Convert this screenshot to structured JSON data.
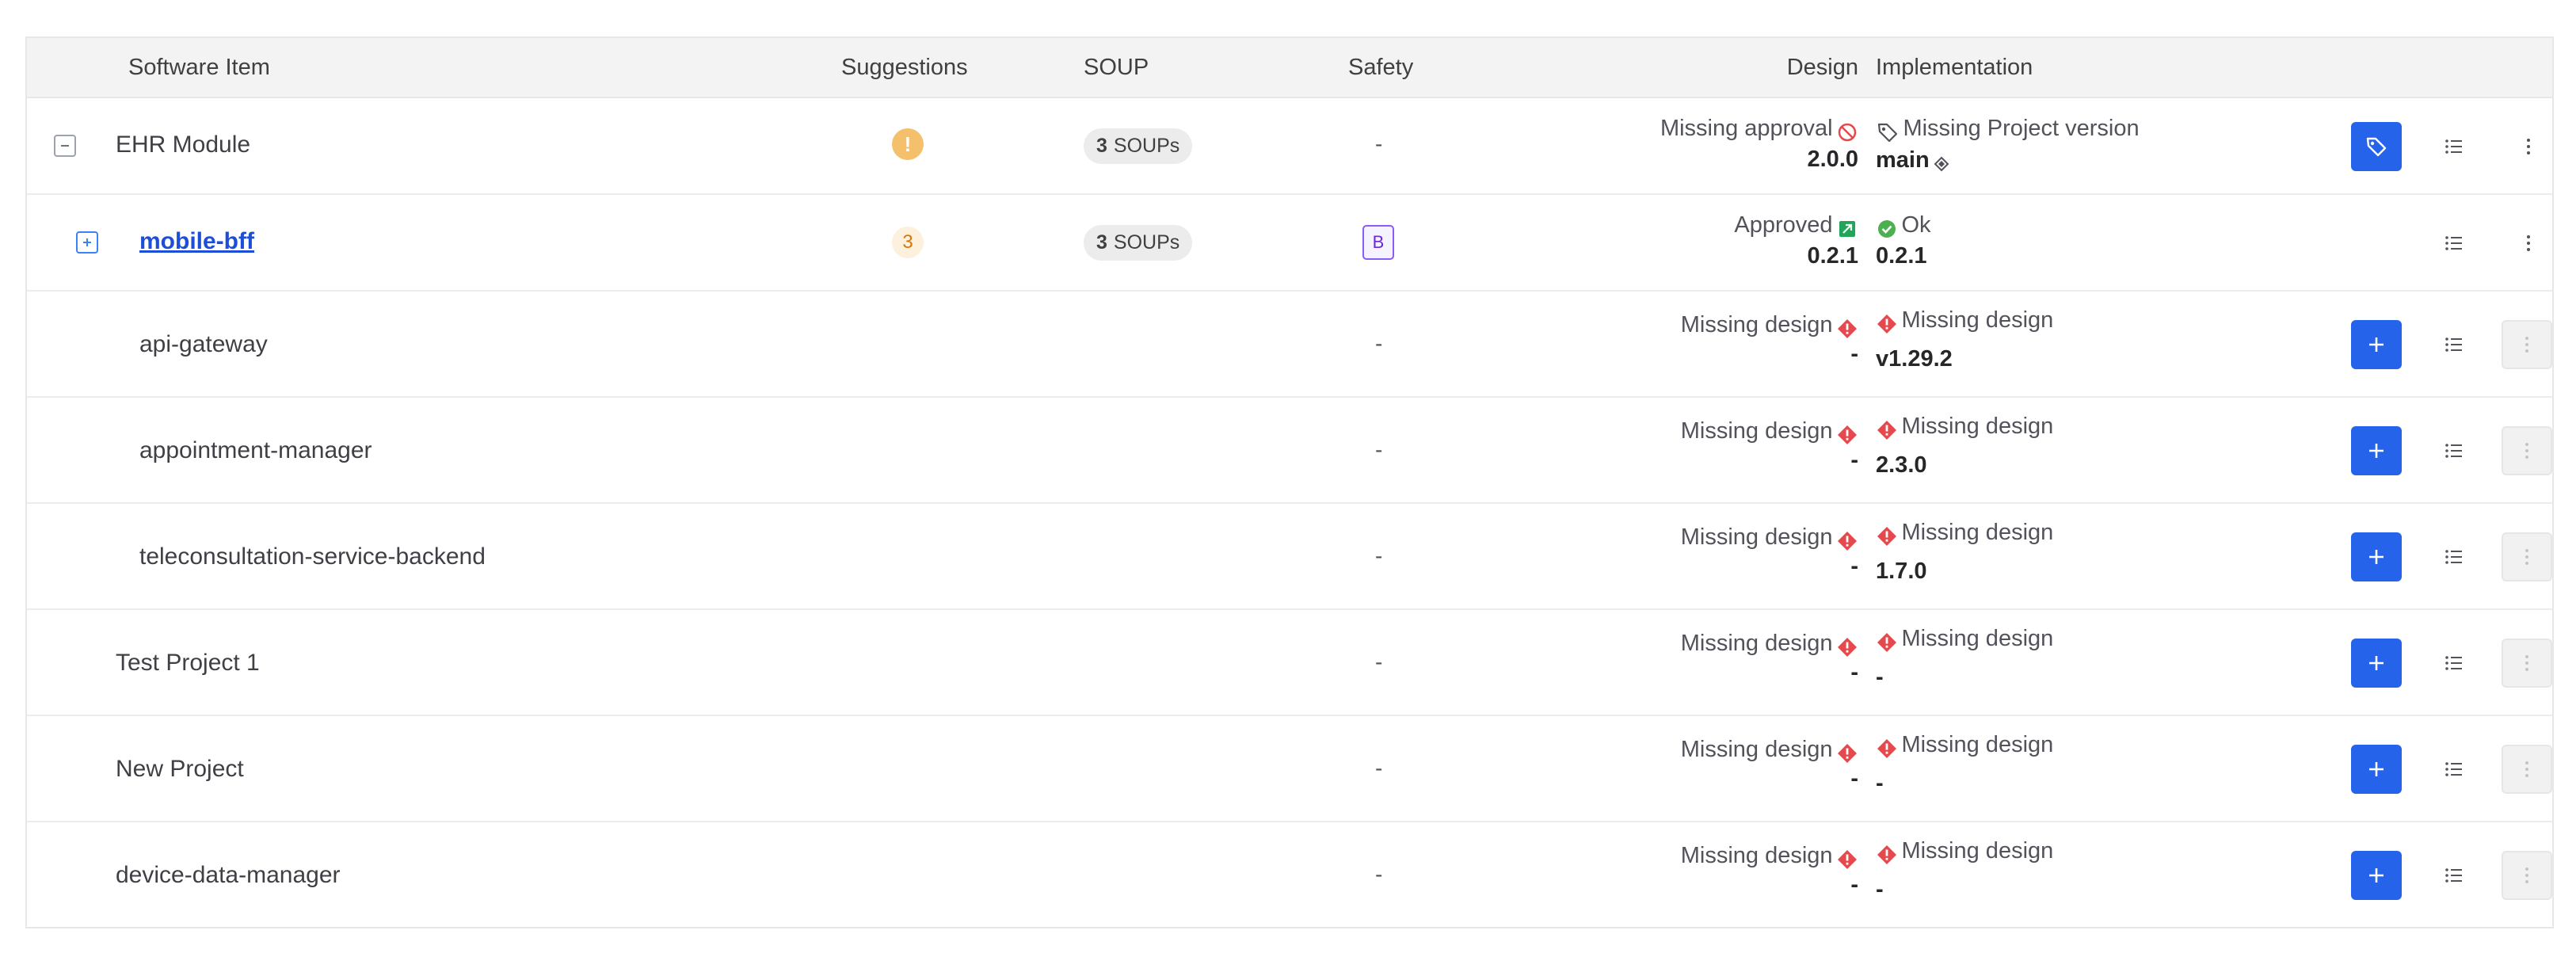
{
  "headers": {
    "software_item": "Software Item",
    "suggestions": "Suggestions",
    "soup": "SOUP",
    "safety": "Safety",
    "design": "Design",
    "implementation": "Implementation"
  },
  "rows": [
    {
      "name": "EHR Module",
      "suggestion_badge": "!",
      "soup_count": "3",
      "soup_label": "SOUPs",
      "safety": "-",
      "design_status": "Missing approval",
      "design_version": "2.0.0",
      "impl_status": "Missing Project version",
      "impl_version": "main"
    },
    {
      "name": "mobile-bff",
      "suggestion_count": "3",
      "soup_count": "3",
      "soup_label": "SOUPs",
      "safety_class": "B",
      "design_status": "Approved",
      "design_version": "0.2.1",
      "impl_status": "Ok",
      "impl_version": "0.2.1"
    },
    {
      "name": "api-gateway",
      "safety": "-",
      "design_status": "Missing design",
      "design_version": "-",
      "impl_status": "Missing design",
      "impl_version": "v1.29.2"
    },
    {
      "name": "appointment-manager",
      "safety": "-",
      "design_status": "Missing design",
      "design_version": "-",
      "impl_status": "Missing design",
      "impl_version": "2.3.0"
    },
    {
      "name": "teleconsultation-service-backend",
      "safety": "-",
      "design_status": "Missing design",
      "design_version": "-",
      "impl_status": "Missing design",
      "impl_version": "1.7.0"
    },
    {
      "name": "Test Project 1",
      "safety": "-",
      "design_status": "Missing design",
      "design_version": "-",
      "impl_status": "Missing design",
      "impl_version": "-"
    },
    {
      "name": "New Project",
      "safety": "-",
      "design_status": "Missing design",
      "design_version": "-",
      "impl_status": "Missing design",
      "impl_version": "-"
    },
    {
      "name": "device-data-manager",
      "safety": "-",
      "design_status": "Missing design",
      "design_version": "-",
      "impl_status": "Missing design",
      "impl_version": "-"
    }
  ],
  "colors": {
    "primary": "#2563eb",
    "warning": "#f5c06b",
    "error": "#e5484d",
    "success": "#4caf50",
    "approved": "#22a559",
    "safety_purple": "#8b5cf6"
  }
}
